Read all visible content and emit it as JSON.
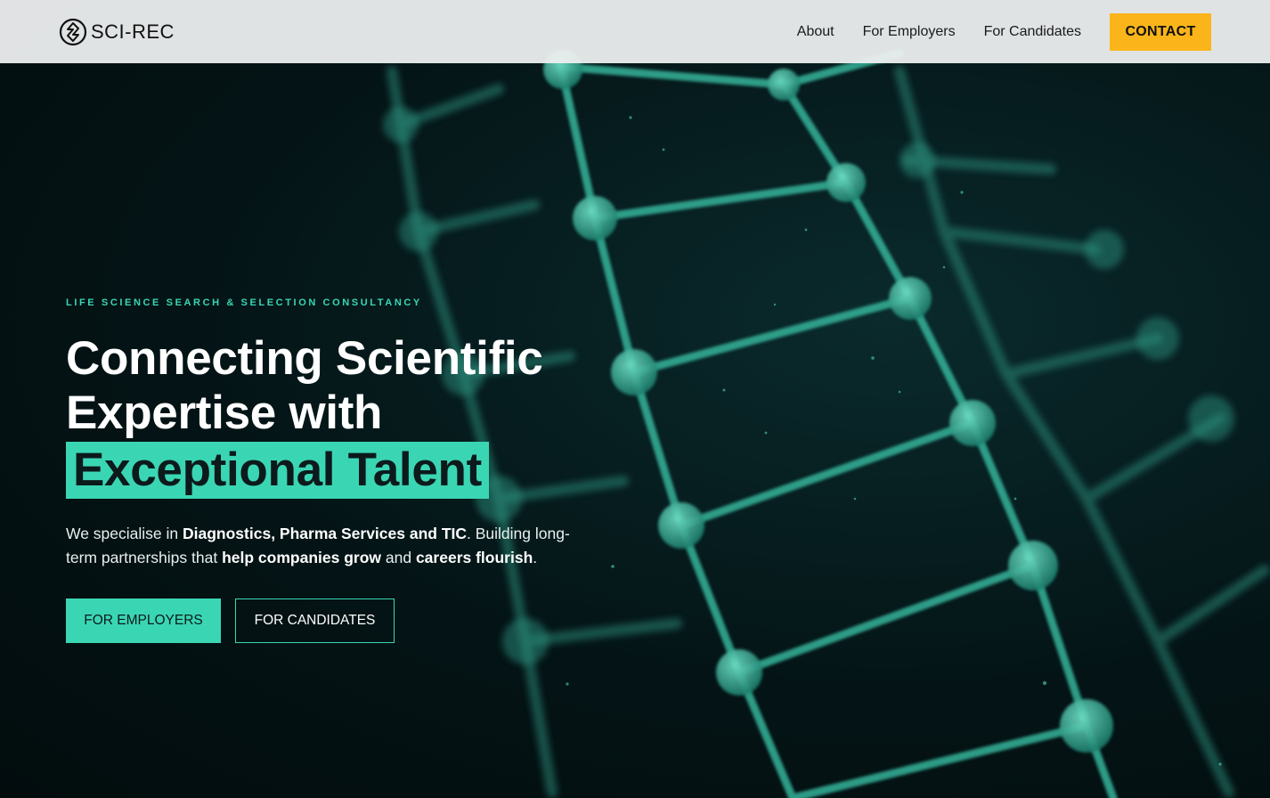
{
  "header": {
    "logo_text": "SCI-REC",
    "nav": [
      {
        "label": "About"
      },
      {
        "label": "For Employers"
      },
      {
        "label": "For Candidates"
      }
    ],
    "contact_label": "CONTACT"
  },
  "hero": {
    "eyebrow": "LIFE SCIENCE SEARCH & SELECTION CONSULTANCY",
    "headline_line1": "Connecting Scientific",
    "headline_line2": "Expertise with",
    "headline_highlight": "Exceptional Talent",
    "desc": {
      "p1": "We specialise in ",
      "b1": "Diagnostics, Pharma Services and TIC",
      "p2": ". Building long-term partnerships that ",
      "b2": "help companies grow",
      "p3": " and ",
      "b3": "careers flourish",
      "p4": "."
    },
    "btn_employers": "FOR EMPLOYERS",
    "btn_candidates": "FOR CANDIDATES"
  },
  "colors": {
    "accent": "#3ad6b4",
    "contact": "#fbb51a",
    "background": "#041416"
  },
  "icons": [
    "sci-rec-logo-icon",
    "dna-molecule-background"
  ]
}
